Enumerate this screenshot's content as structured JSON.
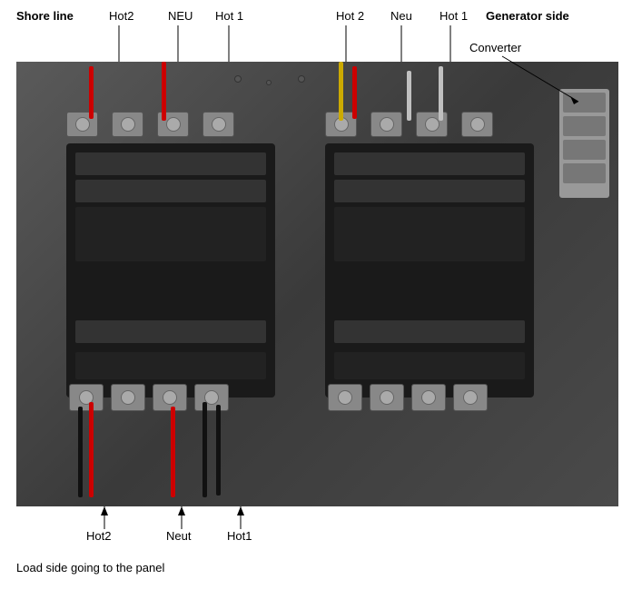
{
  "labels": {
    "shore_line": "Shore line",
    "top_hot2": "Hot2",
    "top_neu": "NEU",
    "top_hot1": "Hot 1",
    "top_hot2b": "Hot 2",
    "top_neu2": "Neu",
    "top_hot1b": "Hot 1",
    "generator_side": "Generator side",
    "converter": "Converter",
    "bottom_hot2": "Hot2",
    "bottom_neut": "Neut",
    "bottom_hot1": "Hot1",
    "load_side": "Load side going to the panel"
  },
  "colors": {
    "wire_red": "#cc0000",
    "wire_yellow": "#ccaa00",
    "wire_black": "#111111",
    "panel_bg": "#4a4a4a",
    "terminal_bg": "#888888",
    "contactor_bg": "#1a1a1a"
  }
}
